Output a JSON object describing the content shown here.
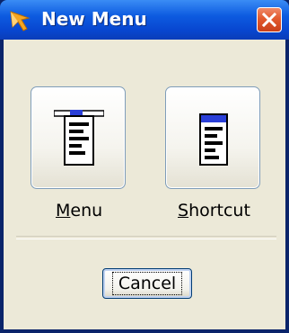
{
  "window": {
    "title": "New Menu",
    "app_icon": "arrow-cursor-icon",
    "close_icon": "close-x-icon"
  },
  "options": [
    {
      "id": "menu",
      "icon": "dropdown-menu-icon",
      "label_mnemonic": "M",
      "label_rest": "enu"
    },
    {
      "id": "shortcut",
      "icon": "shortcut-menu-icon",
      "label_mnemonic": "S",
      "label_rest": "hortcut"
    }
  ],
  "actions": {
    "cancel_label": "Cancel"
  },
  "colors": {
    "titlebar": "#0d5be0",
    "client_bg": "#ece9d8",
    "close_button": "#e25a2e",
    "menu_highlight": "#2a3fd8"
  }
}
